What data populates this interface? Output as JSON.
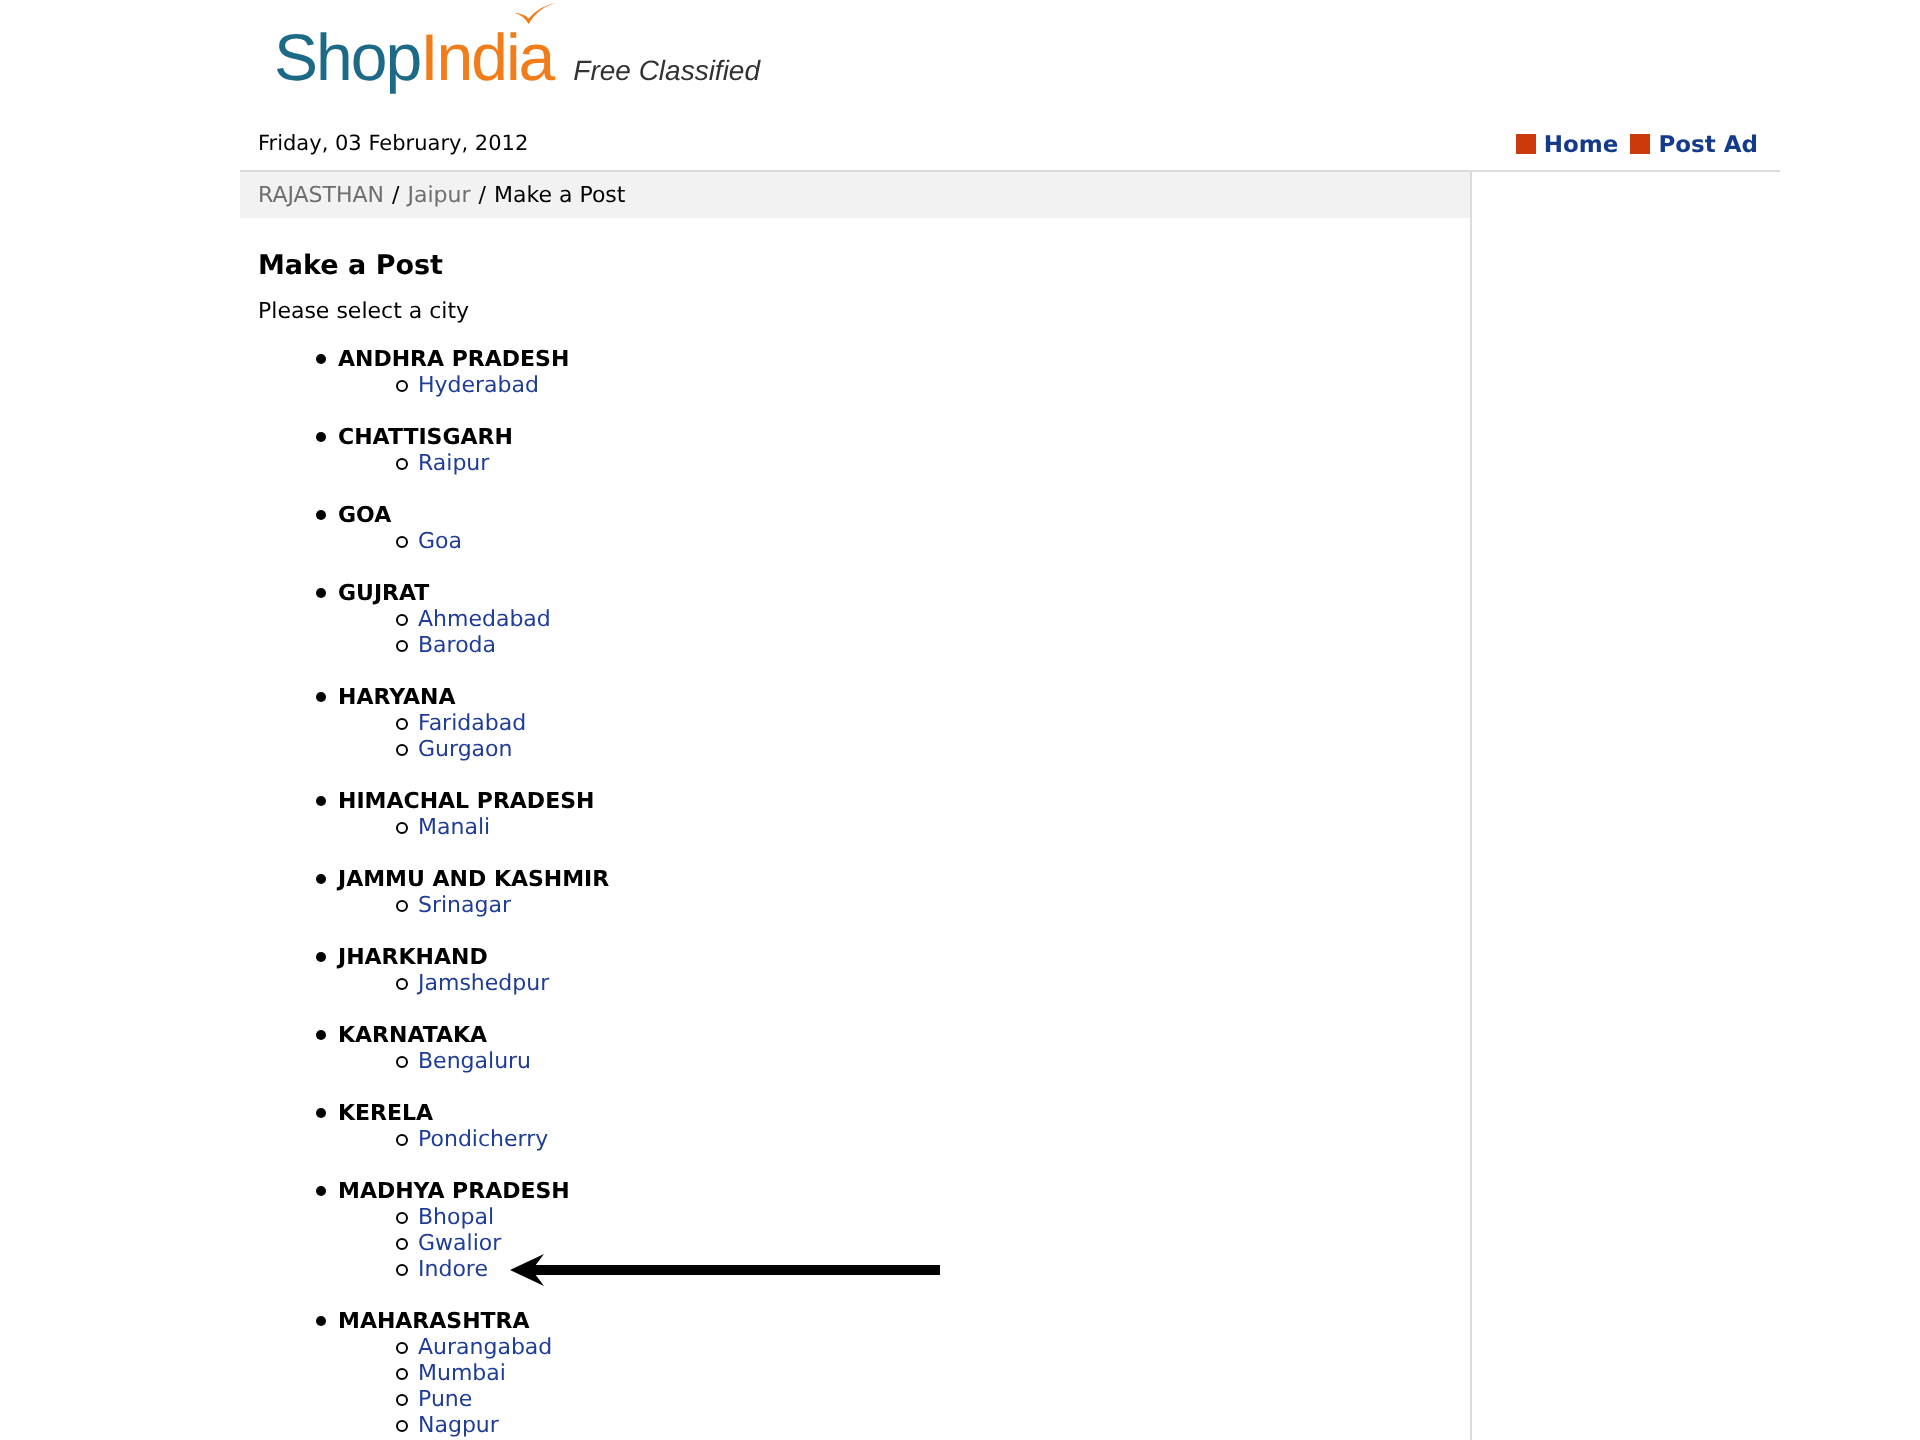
{
  "logo": {
    "primary": "Shop",
    "accent": "India",
    "tagline": "Free Classified"
  },
  "header": {
    "date": "Friday, 03 February, 2012",
    "nav": [
      {
        "label": "Home"
      },
      {
        "label": "Post Ad"
      }
    ]
  },
  "breadcrumb": [
    {
      "kind": "link",
      "label": "RAJASTHAN"
    },
    {
      "kind": "separator",
      "label": "/"
    },
    {
      "kind": "link",
      "label": "Jaipur"
    },
    {
      "kind": "separator",
      "label": "/"
    },
    {
      "kind": "current",
      "label": "Make a Post"
    }
  ],
  "main": {
    "title": "Make a Post",
    "prompt": "Please select a city",
    "states": [
      {
        "name": "ANDHRA PRADESH",
        "cities": [
          {
            "name": "Hyderabad",
            "arrow": false
          }
        ]
      },
      {
        "name": "CHATTISGARH",
        "cities": [
          {
            "name": "Raipur",
            "arrow": false
          }
        ]
      },
      {
        "name": "GOA",
        "cities": [
          {
            "name": "Goa",
            "arrow": false
          }
        ]
      },
      {
        "name": "GUJRAT",
        "cities": [
          {
            "name": "Ahmedabad",
            "arrow": false
          },
          {
            "name": "Baroda",
            "arrow": false
          }
        ]
      },
      {
        "name": "HARYANA",
        "cities": [
          {
            "name": "Faridabad",
            "arrow": false
          },
          {
            "name": "Gurgaon",
            "arrow": false
          }
        ]
      },
      {
        "name": "HIMACHAL PRADESH",
        "cities": [
          {
            "name": "Manali",
            "arrow": false
          }
        ]
      },
      {
        "name": "JAMMU AND KASHMIR",
        "cities": [
          {
            "name": "Srinagar",
            "arrow": false
          }
        ]
      },
      {
        "name": "JHARKHAND",
        "cities": [
          {
            "name": "Jamshedpur",
            "arrow": false
          }
        ]
      },
      {
        "name": "KARNATAKA",
        "cities": [
          {
            "name": "Bengaluru",
            "arrow": false
          }
        ]
      },
      {
        "name": "KERELA",
        "cities": [
          {
            "name": "Pondicherry",
            "arrow": false
          }
        ]
      },
      {
        "name": "MADHYA PRADESH",
        "cities": [
          {
            "name": "Bhopal",
            "arrow": false
          },
          {
            "name": "Gwalior",
            "arrow": false
          },
          {
            "name": "Indore",
            "arrow": true
          }
        ]
      },
      {
        "name": "MAHARASHTRA",
        "cities": [
          {
            "name": "Aurangabad",
            "arrow": false
          },
          {
            "name": "Mumbai",
            "arrow": false
          },
          {
            "name": "Pune",
            "arrow": false
          },
          {
            "name": "Nagpur",
            "arrow": false
          }
        ]
      }
    ]
  }
}
